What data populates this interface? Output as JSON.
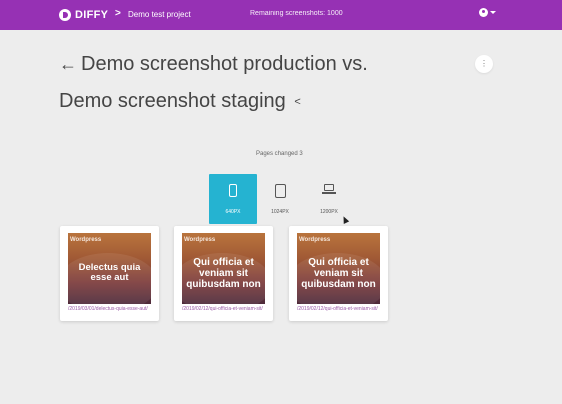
{
  "header": {
    "logo_text": "DIFFY",
    "breadcrumb_separator": ">",
    "project_name": "Demo test project",
    "remaining": "Remaining screenshots: 1000",
    "user_icon": "account-circle-icon",
    "menu_caret": "caret-down-icon",
    "background_color": "#9631b4"
  },
  "comparison": {
    "back_icon": "←",
    "title_line1": "Demo screenshot production vs.",
    "title_line2": "Demo screenshot staging",
    "share_icon": "<",
    "more_icon": "⋮"
  },
  "summary": {
    "pages_changed": "Pages changed 3"
  },
  "devices": [
    {
      "label": "640PX",
      "icon": "phone-icon",
      "active": true
    },
    {
      "label": "1024PX",
      "icon": "tablet-icon",
      "active": false
    },
    {
      "label": "1200PX",
      "icon": "laptop-icon",
      "active": false
    }
  ],
  "accent_color": "#25b3d1",
  "cards": [
    {
      "brand": "Wordpress",
      "title": "Delectus quia esse aut",
      "url": "/2019/03/01/delectus-quia-esse-aut/"
    },
    {
      "brand": "Wordpress",
      "title": "Qui officia et veniam sit quibusdam non",
      "url": "/2019/02/12/qui-officia-et-veniam-sit/"
    },
    {
      "brand": "Wordpress",
      "title": "Qui officia et veniam sit quibusdam non",
      "url": "/2019/02/12/qui-officia-et-veniam-sit/"
    }
  ]
}
